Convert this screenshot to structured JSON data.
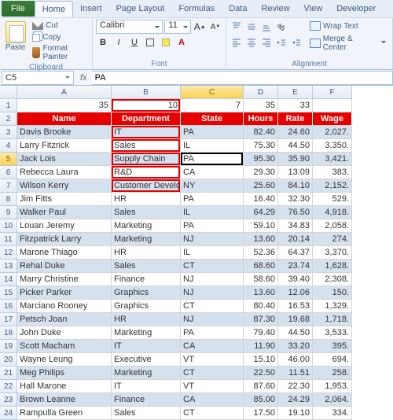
{
  "tabs": {
    "file": "File",
    "home": "Home",
    "insert": "Insert",
    "page_layout": "Page Layout",
    "formulas": "Formulas",
    "data": "Data",
    "review": "Review",
    "view": "View",
    "developer": "Developer"
  },
  "clipboard": {
    "paste": "Paste",
    "cut": "Cut",
    "copy": "Copy",
    "format_painter": "Format Painter",
    "label": "Clipboard"
  },
  "font": {
    "name": "Calibri",
    "size": "11",
    "label": "Font"
  },
  "alignment": {
    "wrap": "Wrap Text",
    "merge": "Merge & Center",
    "label": "Alignment"
  },
  "name_box": "C5",
  "formula": "PA",
  "columns": [
    "A",
    "B",
    "C",
    "D",
    "E",
    "F"
  ],
  "row1": {
    "A": "35",
    "B": "10",
    "C": "7",
    "D": "35",
    "E": "33",
    "F": ""
  },
  "headers": {
    "A": "Name",
    "B": "Department",
    "C": "State",
    "D": "Hours",
    "E": "Rate",
    "F": "Wage"
  },
  "chart_data": {
    "type": "table",
    "columns": [
      "Name",
      "Department",
      "State",
      "Hours",
      "Rate",
      "Wage"
    ],
    "rows": [
      {
        "row": 3,
        "Name": "Davis Brooke",
        "Department": "IT",
        "State": "PA",
        "Hours": 82.4,
        "Rate": 24.6,
        "Wage": 2027.0
      },
      {
        "row": 4,
        "Name": "Larry Fitzrick",
        "Department": "Sales",
        "State": "IL",
        "Hours": 75.3,
        "Rate": 44.5,
        "Wage": 3350.0
      },
      {
        "row": 5,
        "Name": "Jack Lois",
        "Department": "Supply Chain",
        "State": "PA",
        "Hours": 95.3,
        "Rate": 35.9,
        "Wage": 3421.0
      },
      {
        "row": 6,
        "Name": "Rebecca Laura",
        "Department": "R&D",
        "State": "CA",
        "Hours": 29.3,
        "Rate": 13.09,
        "Wage": 383.0
      },
      {
        "row": 7,
        "Name": "Wilson Kerry",
        "Department": "Customer Developm",
        "State": "NY",
        "Hours": 25.6,
        "Rate": 84.1,
        "Wage": 2152.0
      },
      {
        "row": 8,
        "Name": "Jim Fitts",
        "Department": "HR",
        "State": "PA",
        "Hours": 16.4,
        "Rate": 32.3,
        "Wage": 529.0
      },
      {
        "row": 9,
        "Name": "Walker Paul",
        "Department": "Sales",
        "State": "IL",
        "Hours": 64.29,
        "Rate": 76.5,
        "Wage": 4918.0
      },
      {
        "row": 10,
        "Name": "Louan Jeremy",
        "Department": "Marketing",
        "State": "PA",
        "Hours": 59.1,
        "Rate": 34.83,
        "Wage": 2058.0
      },
      {
        "row": 11,
        "Name": "Fitzpatrick Larry",
        "Department": "Marketing",
        "State": "NJ",
        "Hours": 13.6,
        "Rate": 20.14,
        "Wage": 274.0
      },
      {
        "row": 12,
        "Name": "Marone Thiago",
        "Department": "HR",
        "State": "IL",
        "Hours": 52.36,
        "Rate": 64.37,
        "Wage": 3370.0
      },
      {
        "row": 13,
        "Name": "Rehal Duke",
        "Department": "Sales",
        "State": "CT",
        "Hours": 68.6,
        "Rate": 23.74,
        "Wage": 1628.0
      },
      {
        "row": 14,
        "Name": "Marry Christine",
        "Department": "Finance",
        "State": "NJ",
        "Hours": 58.6,
        "Rate": 39.4,
        "Wage": 2308.0
      },
      {
        "row": 15,
        "Name": "Picker Parker",
        "Department": "Graphics",
        "State": "NJ",
        "Hours": 13.6,
        "Rate": 12.06,
        "Wage": 150.0
      },
      {
        "row": 16,
        "Name": "Marciano Rooney",
        "Department": "Graphics",
        "State": "CT",
        "Hours": 80.4,
        "Rate": 16.53,
        "Wage": 1329.0
      },
      {
        "row": 17,
        "Name": "Petsch Joan",
        "Department": "HR",
        "State": "NJ",
        "Hours": 87.3,
        "Rate": 19.68,
        "Wage": 1718.0
      },
      {
        "row": 18,
        "Name": "John Duke",
        "Department": "Marketing",
        "State": "PA",
        "Hours": 79.4,
        "Rate": 44.5,
        "Wage": 3533.0
      },
      {
        "row": 19,
        "Name": "Scott Macham",
        "Department": "IT",
        "State": "CA",
        "Hours": 11.9,
        "Rate": 33.2,
        "Wage": 395.0
      },
      {
        "row": 20,
        "Name": "Wayne Leung",
        "Department": "Executive",
        "State": "VT",
        "Hours": 15.1,
        "Rate": 46.0,
        "Wage": 694.0
      },
      {
        "row": 21,
        "Name": "Meg Philips",
        "Department": "Marketing",
        "State": "CT",
        "Hours": 22.5,
        "Rate": 11.51,
        "Wage": 258.0
      },
      {
        "row": 22,
        "Name": "Hall Marone",
        "Department": "IT",
        "State": "VT",
        "Hours": 87.6,
        "Rate": 22.3,
        "Wage": 1953.0
      },
      {
        "row": 23,
        "Name": "Brown Leanne",
        "Department": "Finance",
        "State": "CA",
        "Hours": 85.0,
        "Rate": 24.29,
        "Wage": 2064.0
      },
      {
        "row": 24,
        "Name": "Rampulla Green",
        "Department": "Sales",
        "State": "CT",
        "Hours": 17.5,
        "Rate": 19.1,
        "Wage": 334.0
      }
    ]
  },
  "selection": {
    "active_cell": "C5",
    "red_outline": "B1:B7",
    "active_row": 5,
    "active_col": "C"
  }
}
